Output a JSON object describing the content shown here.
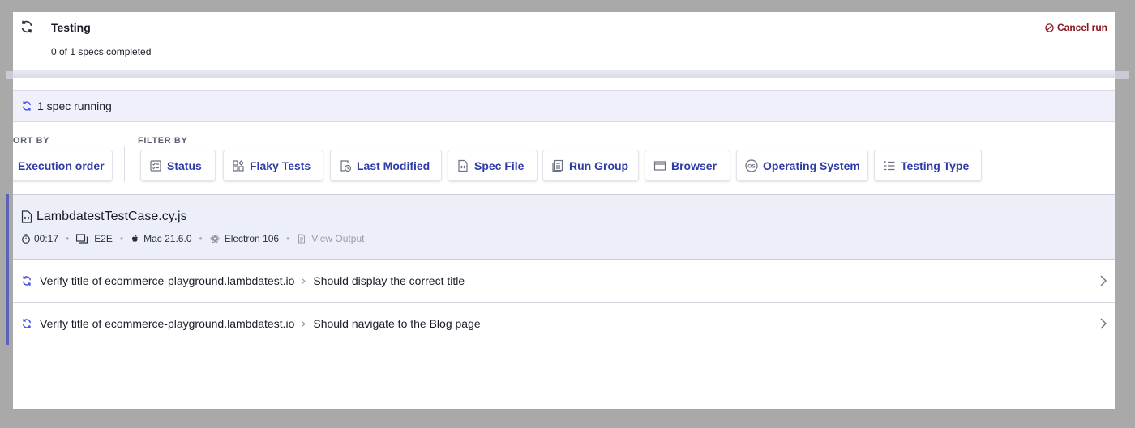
{
  "header": {
    "title": "Testing",
    "subtitle": "0 of 1 specs completed",
    "cancel_label": "Cancel run"
  },
  "running": {
    "label": "1 spec running"
  },
  "sort": {
    "section_label": "SORT BY",
    "value": "Execution order"
  },
  "filter": {
    "section_label": "FILTER BY",
    "items": [
      {
        "label": "Status",
        "icon": "status-icon"
      },
      {
        "label": "Flaky Tests",
        "icon": "flaky-tests-icon"
      },
      {
        "label": "Last Modified",
        "icon": "last-modified-icon"
      },
      {
        "label": "Spec File",
        "icon": "spec-file-icon"
      },
      {
        "label": "Run Group",
        "icon": "run-group-icon"
      },
      {
        "label": "Browser",
        "icon": "browser-icon"
      },
      {
        "label": "Operating System",
        "icon": "os-icon"
      },
      {
        "label": "Testing Type",
        "icon": "testing-type-icon"
      }
    ]
  },
  "spec": {
    "file_name": "LambdatestTestCase.cy.js",
    "duration": "00:17",
    "testing_type": "E2E",
    "os": "Mac 21.6.0",
    "browser": "Electron 106",
    "view_output_label": "View Output"
  },
  "tests": [
    {
      "suite": "Verify title of ecommerce-playground.lambdatest.io",
      "test": "Should display the correct title"
    },
    {
      "suite": "Verify title of ecommerce-playground.lambdatest.io",
      "test": "Should navigate to the Blog page"
    }
  ],
  "colors": {
    "accent": "#2e3aa6",
    "cancel": "#8a1620",
    "running_bg": "#eff0f9",
    "spec_bg": "#eceef8"
  }
}
